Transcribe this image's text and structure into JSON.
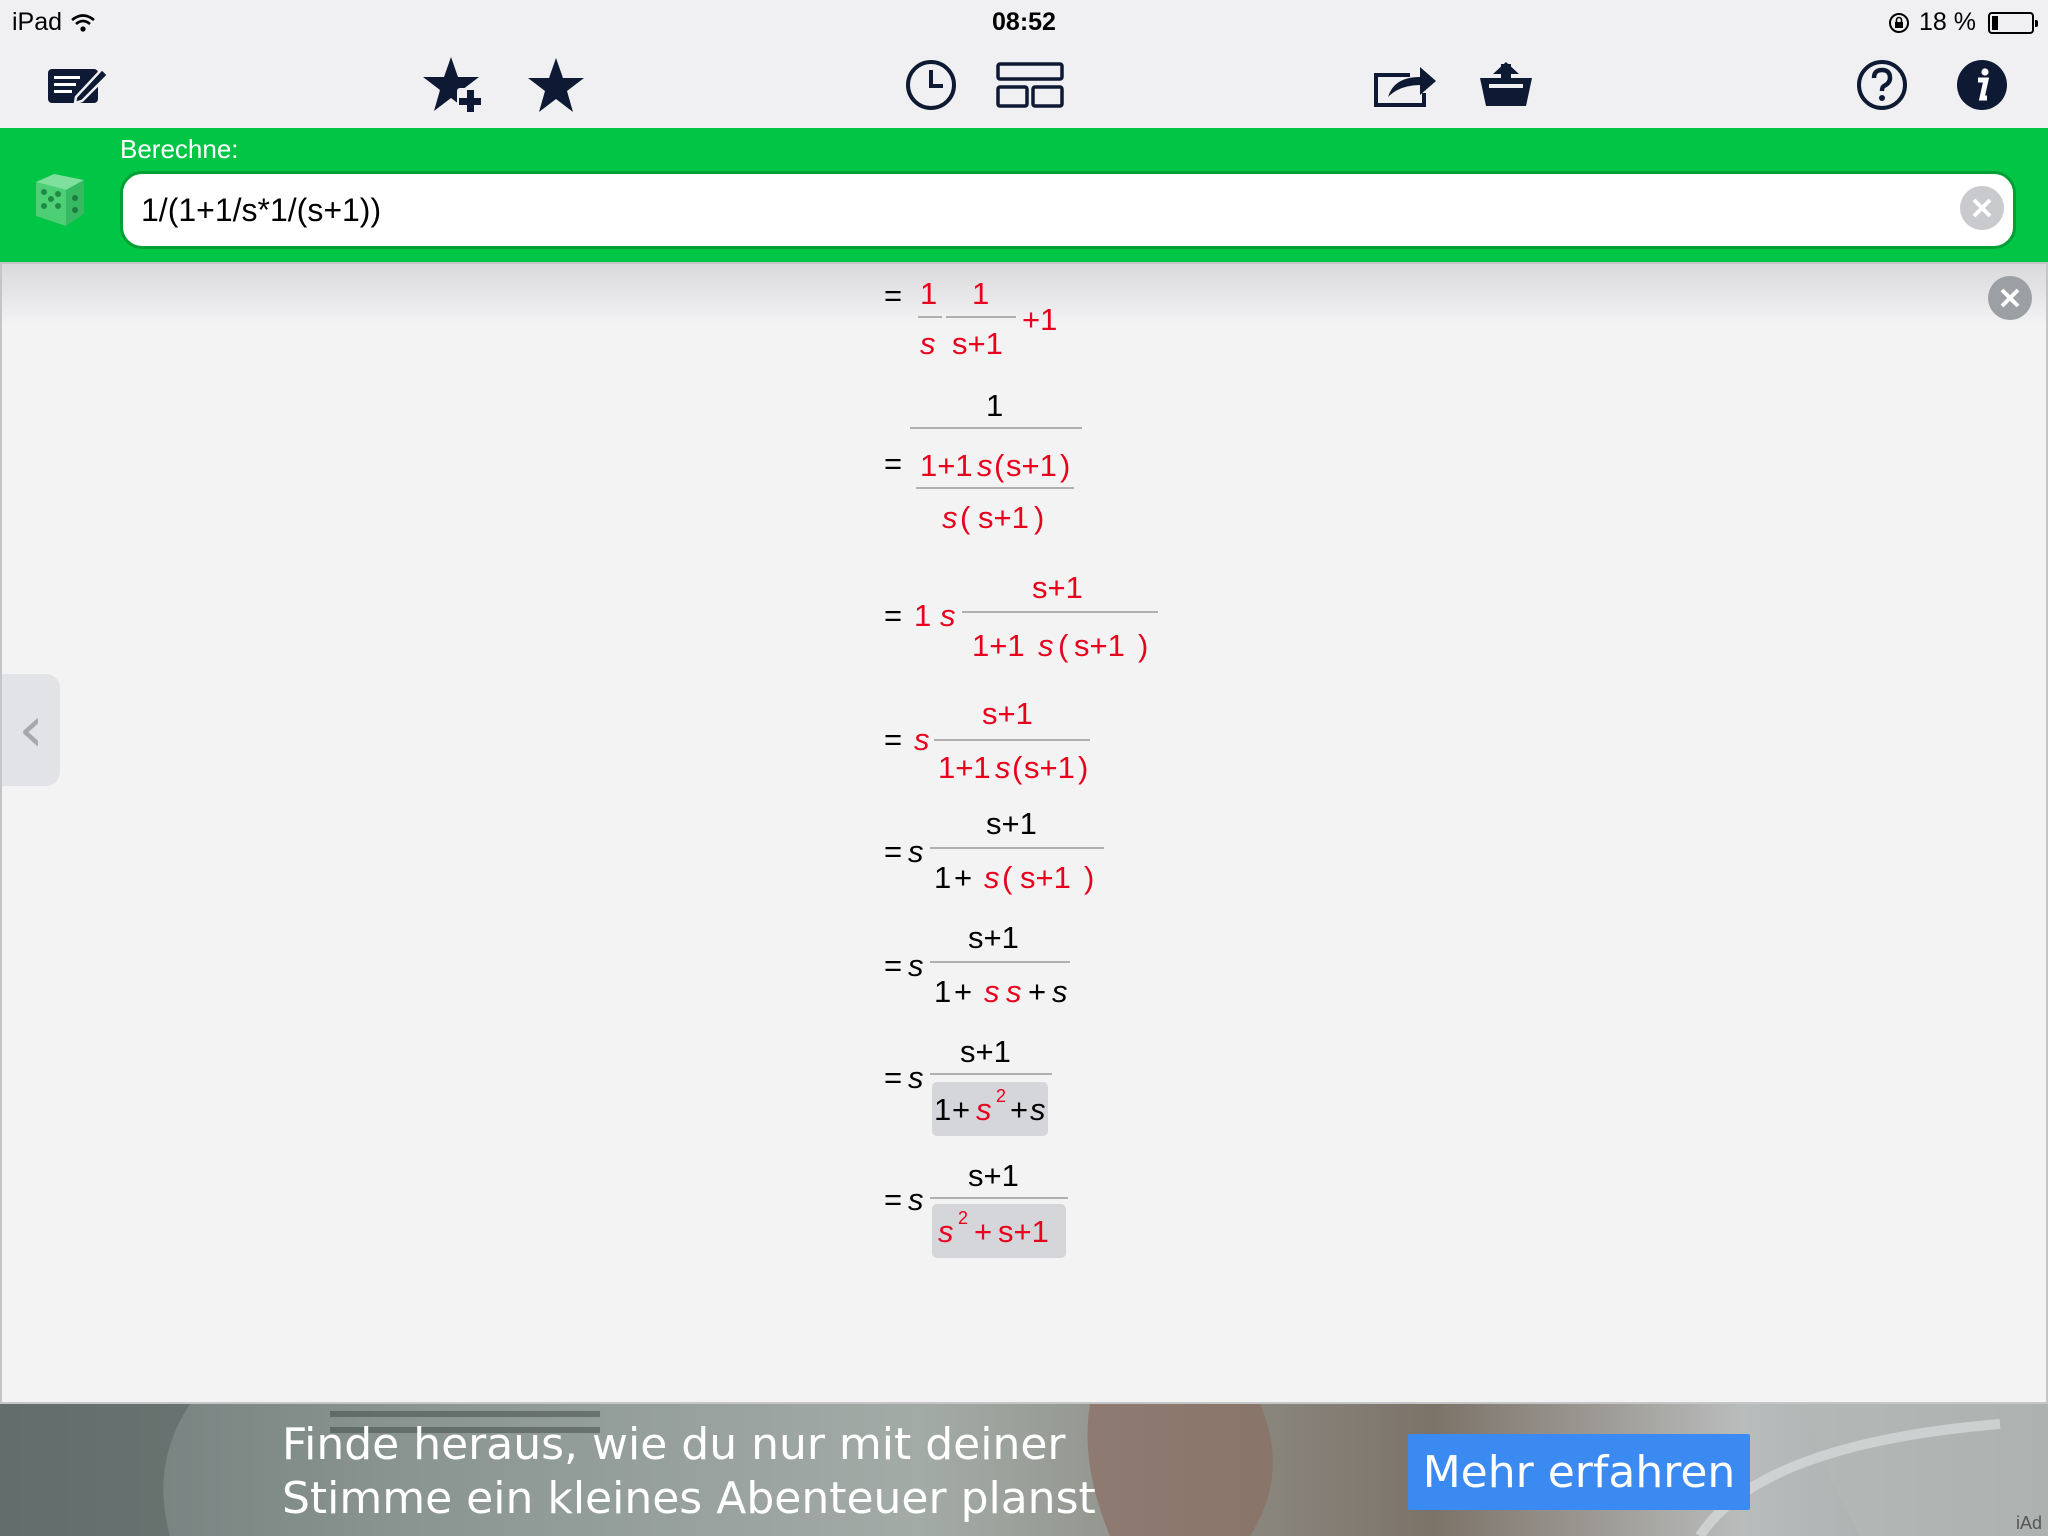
{
  "status_bar": {
    "device": "iPad",
    "time": "08:52",
    "battery": "18 %",
    "battery_level": 0.18
  },
  "toolbar": {
    "icons": [
      "edit-notes-icon",
      "add-favorite-icon",
      "favorites-icon",
      "history-icon",
      "layout-icon",
      "share-icon",
      "export-icon",
      "help-icon",
      "info-icon"
    ]
  },
  "calculator": {
    "label": "Berechne:",
    "input_value": "1/(1+1/s*1/(s+1))"
  },
  "steps": {
    "eq": "=",
    "s": "s",
    "one": "1",
    "plus": "+",
    "plus_one": "+1",
    "s_plus_1": "s+1",
    "sq": "2",
    "n_one_plus_one_s": "1+1",
    "n_paren_open": "(",
    "n_paren_close": ")",
    "step3_1": "1"
  },
  "colors": {
    "highlight": "#e8001c",
    "accent_green": "#00c545",
    "icon_dark": "#0e1a33",
    "ad_button": "#3b8af2"
  },
  "ad": {
    "line1": "Finde heraus, wie du nur mit deiner",
    "line2": "Stimme ein kleines Abenteuer planst",
    "button": "Mehr erfahren",
    "mark": "iAd"
  }
}
